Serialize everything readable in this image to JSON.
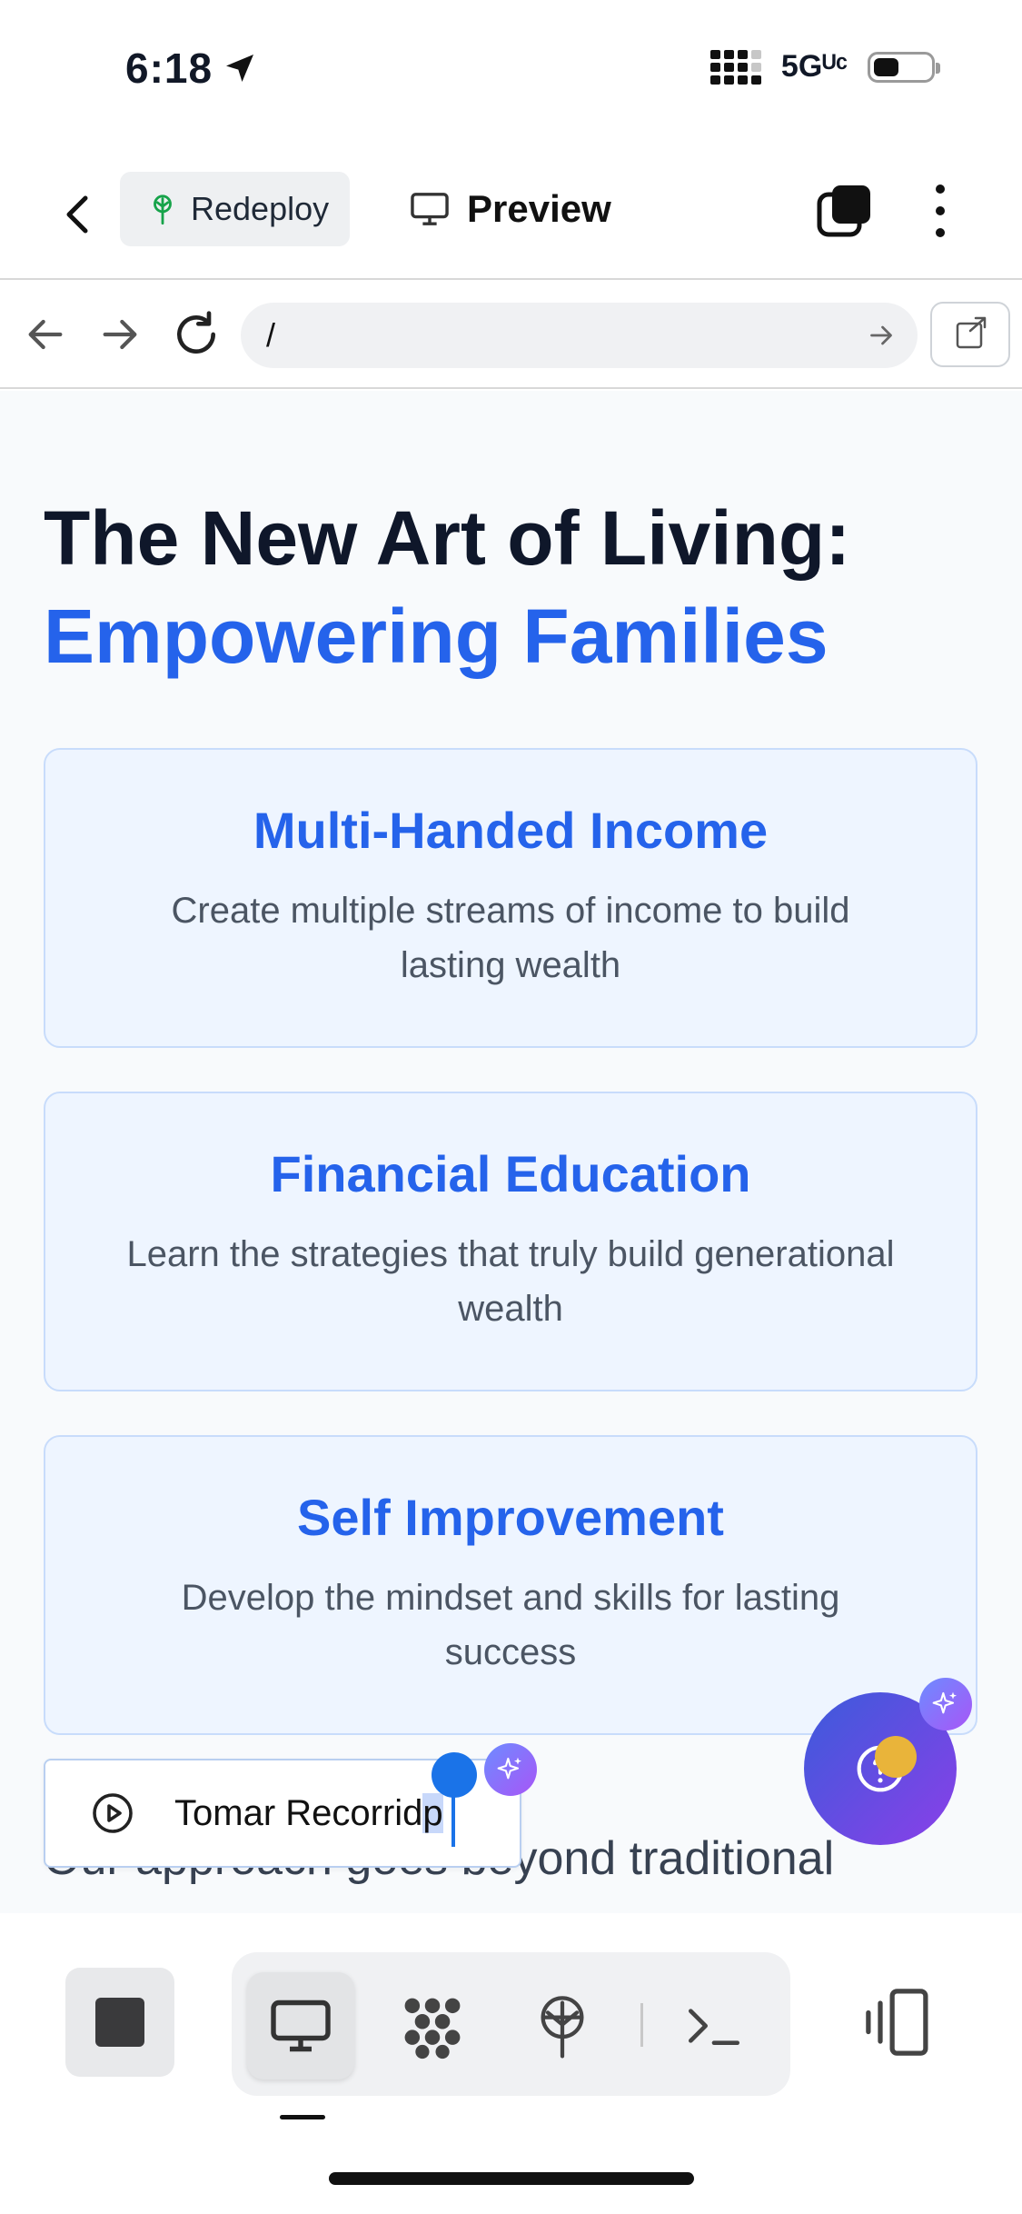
{
  "status_bar": {
    "time": "6:18",
    "network": "5Gᵁᶜ"
  },
  "header": {
    "redeploy_label": "Redeploy",
    "preview_label": "Preview"
  },
  "browser": {
    "url": "/"
  },
  "hero": {
    "title_line1": "The New Art of Living:",
    "title_line2": "Empowering Families"
  },
  "cards": [
    {
      "title": "Multi-Handed Income",
      "description": "Create multiple streams of income to build lasting wealth"
    },
    {
      "title": "Financial Education",
      "description": "Learn the strategies that truly build generational wealth"
    },
    {
      "title": "Self Improvement",
      "description": "Develop the mindset and skills for lasting success"
    }
  ],
  "body_text": "Our approach goes beyond traditional",
  "recording": {
    "label_main": "Tomar Recorrid",
    "label_selected": "p"
  },
  "colors": {
    "accent": "#2563eb",
    "card_bg": "#eef5ff",
    "fab_gradient_start": "#3b5bdb",
    "fab_gradient_end": "#8b3fe8"
  },
  "icons": {
    "back": "chevron-left-icon",
    "redeploy": "deploy-tree-icon",
    "preview": "monitor-icon",
    "tabs": "tabs-icon",
    "more": "more-vertical-icon",
    "nav_back": "arrow-left-icon",
    "nav_forward": "arrow-right-icon",
    "reload": "reload-icon",
    "go": "arrow-right-icon",
    "external": "external-link-icon",
    "play": "play-circle-icon",
    "help": "help-icon",
    "sparkle": "sparkle-icon",
    "stop": "stop-icon",
    "desktop": "monitor-icon",
    "agent": "agent-dots-icon",
    "deploy": "deploy-tree-icon",
    "terminal": "terminal-icon",
    "devices": "device-switch-icon"
  }
}
